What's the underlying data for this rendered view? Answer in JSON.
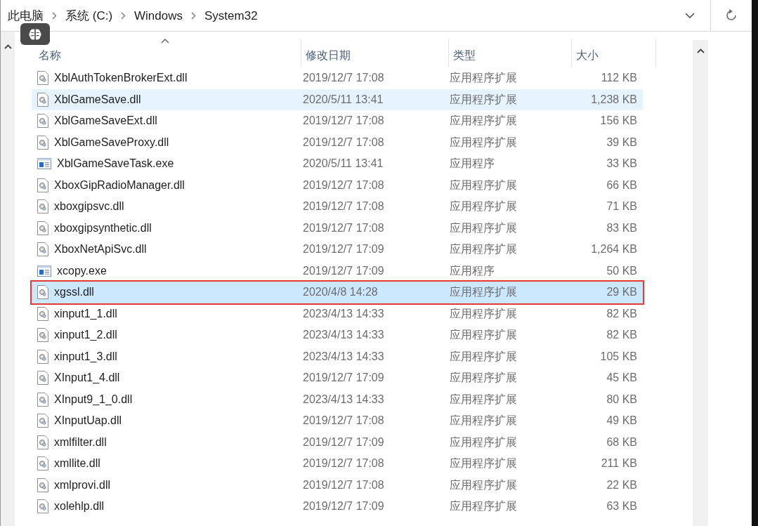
{
  "breadcrumb": [
    "此电脑",
    "系统 (C:)",
    "Windows",
    "System32"
  ],
  "columns": [
    {
      "label": "名称",
      "sorted": true
    },
    {
      "label": "修改日期",
      "sorted": false
    },
    {
      "label": "类型",
      "sorted": false
    },
    {
      "label": "大小",
      "sorted": false
    }
  ],
  "rows": [
    {
      "name": "XblAuthTokenBrokerExt.dll",
      "kind": "dll",
      "date": "2019/12/7 17:08",
      "type": "应用程序扩展",
      "size": "112 KB",
      "hovered": false,
      "selected": false,
      "marked": false
    },
    {
      "name": "XblGameSave.dll",
      "kind": "dll",
      "date": "2020/5/11 13:41",
      "type": "应用程序扩展",
      "size": "1,238 KB",
      "hovered": true,
      "selected": false,
      "marked": false
    },
    {
      "name": "XblGameSaveExt.dll",
      "kind": "dll",
      "date": "2019/12/7 17:08",
      "type": "应用程序扩展",
      "size": "156 KB",
      "hovered": false,
      "selected": false,
      "marked": false
    },
    {
      "name": "XblGameSaveProxy.dll",
      "kind": "dll",
      "date": "2019/12/7 17:08",
      "type": "应用程序扩展",
      "size": "39 KB",
      "hovered": false,
      "selected": false,
      "marked": false
    },
    {
      "name": "XblGameSaveTask.exe",
      "kind": "exe",
      "date": "2020/5/11 13:41",
      "type": "应用程序",
      "size": "33 KB",
      "hovered": false,
      "selected": false,
      "marked": false
    },
    {
      "name": "XboxGipRadioManager.dll",
      "kind": "dll",
      "date": "2019/12/7 17:08",
      "type": "应用程序扩展",
      "size": "66 KB",
      "hovered": false,
      "selected": false,
      "marked": false
    },
    {
      "name": "xboxgipsvc.dll",
      "kind": "dll",
      "date": "2019/12/7 17:08",
      "type": "应用程序扩展",
      "size": "71 KB",
      "hovered": false,
      "selected": false,
      "marked": false
    },
    {
      "name": "xboxgipsynthetic.dll",
      "kind": "dll",
      "date": "2019/12/7 17:08",
      "type": "应用程序扩展",
      "size": "83 KB",
      "hovered": false,
      "selected": false,
      "marked": false
    },
    {
      "name": "XboxNetApiSvc.dll",
      "kind": "dll",
      "date": "2019/12/7 17:09",
      "type": "应用程序扩展",
      "size": "1,264 KB",
      "hovered": false,
      "selected": false,
      "marked": false
    },
    {
      "name": "xcopy.exe",
      "kind": "exe",
      "date": "2019/12/7 17:09",
      "type": "应用程序",
      "size": "50 KB",
      "hovered": false,
      "selected": false,
      "marked": false
    },
    {
      "name": "xgssl.dll",
      "kind": "dll",
      "date": "2020/4/8 14:28",
      "type": "应用程序扩展",
      "size": "29 KB",
      "hovered": false,
      "selected": true,
      "marked": true
    },
    {
      "name": "xinput1_1.dll",
      "kind": "dll",
      "date": "2023/4/13 14:33",
      "type": "应用程序扩展",
      "size": "82 KB",
      "hovered": false,
      "selected": false,
      "marked": false
    },
    {
      "name": "xinput1_2.dll",
      "kind": "dll",
      "date": "2023/4/13 14:33",
      "type": "应用程序扩展",
      "size": "82 KB",
      "hovered": false,
      "selected": false,
      "marked": false
    },
    {
      "name": "xinput1_3.dll",
      "kind": "dll",
      "date": "2023/4/13 14:33",
      "type": "应用程序扩展",
      "size": "105 KB",
      "hovered": false,
      "selected": false,
      "marked": false
    },
    {
      "name": "XInput1_4.dll",
      "kind": "dll",
      "date": "2019/12/7 17:09",
      "type": "应用程序扩展",
      "size": "45 KB",
      "hovered": false,
      "selected": false,
      "marked": false
    },
    {
      "name": "XInput9_1_0.dll",
      "kind": "dll",
      "date": "2023/4/13 14:33",
      "type": "应用程序扩展",
      "size": "80 KB",
      "hovered": false,
      "selected": false,
      "marked": false
    },
    {
      "name": "XInputUap.dll",
      "kind": "dll",
      "date": "2019/12/7 17:08",
      "type": "应用程序扩展",
      "size": "49 KB",
      "hovered": false,
      "selected": false,
      "marked": false
    },
    {
      "name": "xmlfilter.dll",
      "kind": "dll",
      "date": "2019/12/7 17:09",
      "type": "应用程序扩展",
      "size": "68 KB",
      "hovered": false,
      "selected": false,
      "marked": false
    },
    {
      "name": "xmllite.dll",
      "kind": "dll",
      "date": "2019/12/7 17:08",
      "type": "应用程序扩展",
      "size": "211 KB",
      "hovered": false,
      "selected": false,
      "marked": false
    },
    {
      "name": "xmlprovi.dll",
      "kind": "dll",
      "date": "2019/12/7 17:08",
      "type": "应用程序扩展",
      "size": "22 KB",
      "hovered": false,
      "selected": false,
      "marked": false
    },
    {
      "name": "xolehlp.dll",
      "kind": "dll",
      "date": "2019/12/7 17:09",
      "type": "应用程序扩展",
      "size": "63 KB",
      "hovered": false,
      "selected": false,
      "marked": false
    }
  ]
}
